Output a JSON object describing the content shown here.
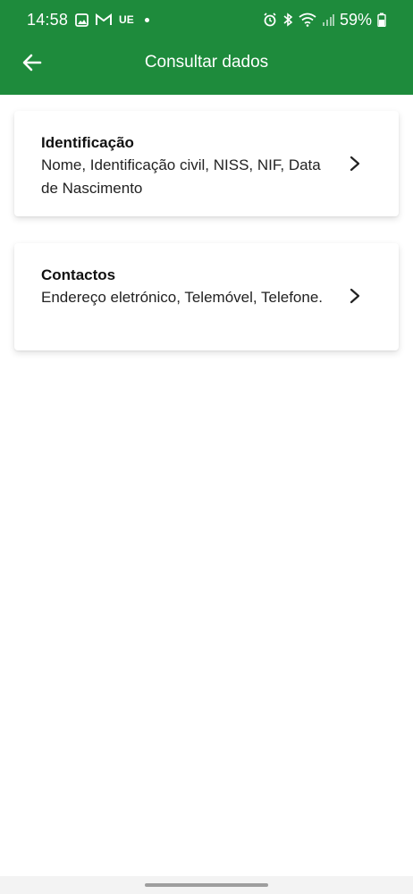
{
  "status_bar": {
    "time": "14:58",
    "carrier_text": "UE",
    "battery": "59%",
    "icons": [
      "image-icon",
      "gmail-icon",
      "alarm-icon",
      "bluetooth-icon",
      "wifi-icon",
      "signal-icon",
      "battery-icon"
    ]
  },
  "app_bar": {
    "title": "Consultar dados",
    "back_icon": "arrow-left-icon"
  },
  "colors": {
    "header": "#1e8b3c",
    "background": "#ffffff"
  },
  "cards": [
    {
      "title": "Identificação",
      "description": "Nome, Identificação civil, NISS, NIF, Data de Nascimento",
      "icon": "chevron-right-icon"
    },
    {
      "title": "Contactos",
      "description": "Endereço eletrónico, Telemóvel, Telefone.",
      "icon": "chevron-right-icon"
    }
  ]
}
